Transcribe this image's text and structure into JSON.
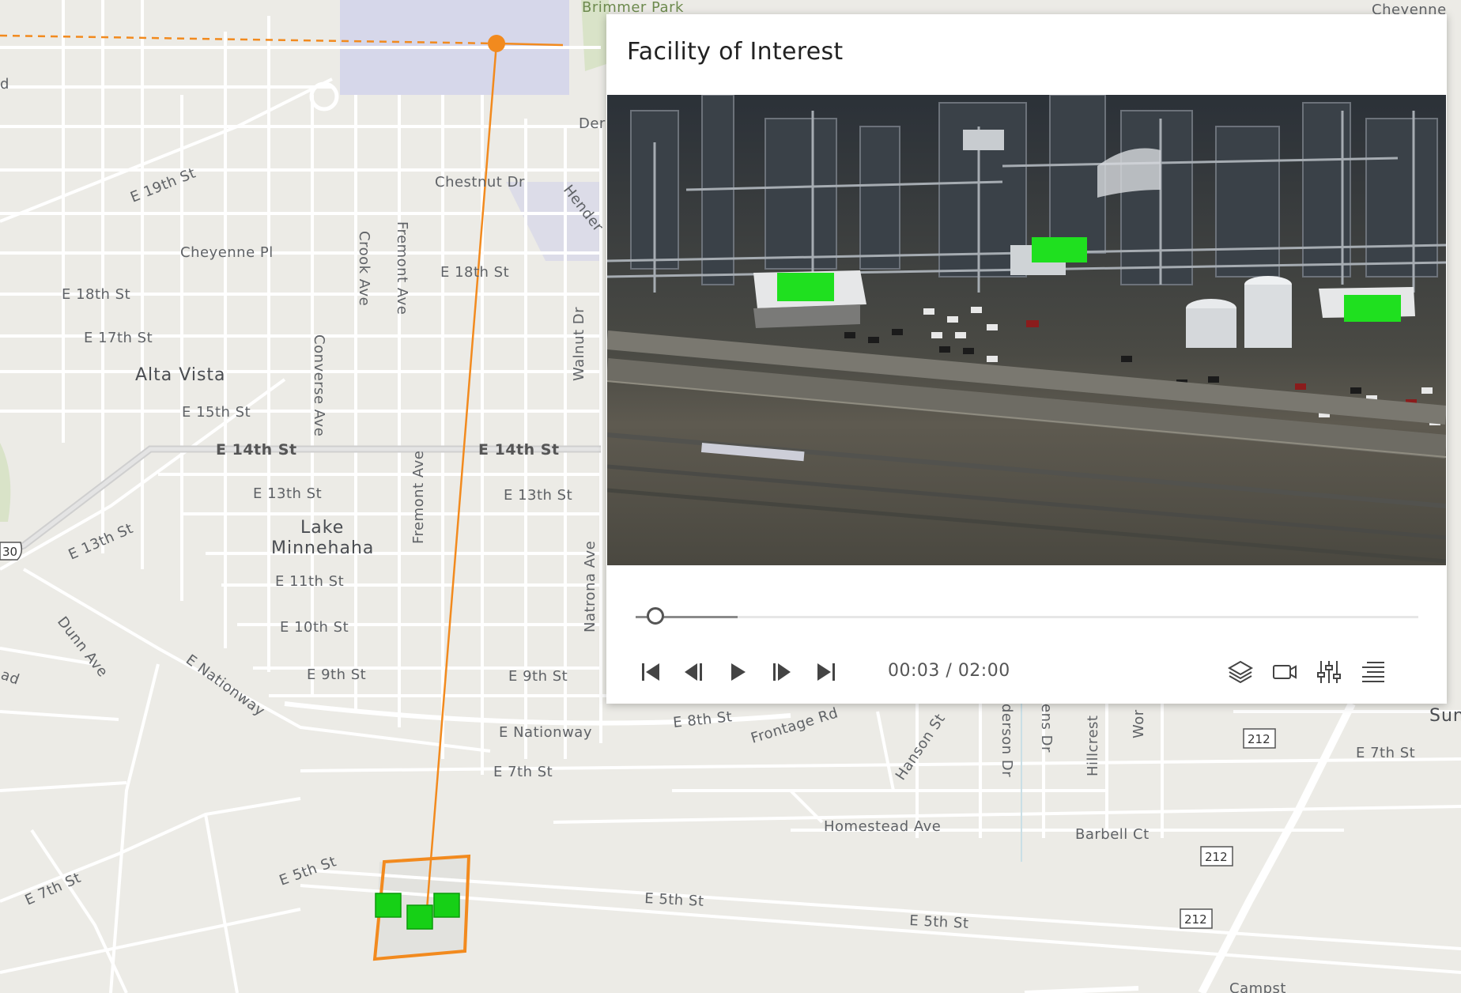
{
  "popup": {
    "title": "Facility of Interest",
    "time_current": "00:03",
    "time_total": "02:00",
    "time_separator": " / ",
    "progress_fraction": 0.025,
    "buffer_fraction": 0.13
  },
  "map": {
    "colors": {
      "background": "#ecebe6",
      "road": "#ffffff",
      "highway": "#d3d3d3",
      "sensor_track": "#f28a1e",
      "footprint": "#f28a1e",
      "detection": "#16d016",
      "park": "#d9e3c8",
      "campus": "#d6d7ea"
    },
    "labels": {
      "brimmer_park": "Brimmer Park",
      "cheyenne_top": "Cheyenne",
      "der": "Der",
      "chestnut_dr": "Chestnut Dr",
      "hender": "Hender",
      "e_19th_st": "E 19th St",
      "cheyenne_pl": "Cheyenne Pl",
      "crook_ave": "Crook Ave",
      "fremont_ave_n": "Fremont Ave",
      "e_18th_st_left": "E 18th St",
      "e_18th_st_right": "E 18th St",
      "e_17th_st": "E 17th St",
      "converse_ave": "Converse Ave",
      "walnut_dr": "Walnut Dr",
      "alta_vista": "Alta Vista",
      "e_15th_st": "E 15th St",
      "e_14th_st_left": "E 14th St",
      "e_14th_st_right": "E 14th St",
      "e_13th_st_a": "E 13th St",
      "e_13th_st_b": "E 13th St",
      "e_13th_st_diag": "E 13th St",
      "lake": "Lake",
      "minnehaha": "Minnehaha",
      "fremont_ave_s": "Fremont Ave",
      "e_11th_st": "E 11th St",
      "natrona_ave": "Natrona Ave",
      "dunn_ave": "Dunn Ave",
      "e_10th_st": "E 10th St",
      "ad": "ad",
      "e_nationway_diag": "E Nationway",
      "e_9th_st_a": "E 9th St",
      "e_9th_st_b": "E 9th St",
      "e_nationway": "E Nationway",
      "e_8th_st": "E 8th St",
      "frontage_rd": "Frontage Rd",
      "hanson_st": "Hanson St",
      "derson_dr": "derson Dr",
      "ens_dr": "ens Dr",
      "hillcrest": "Hillcrest",
      "wor": "Wor",
      "sun": "Sun",
      "e_7th_st_a": "E 7th St",
      "e_7th_st_b": "E 7th St",
      "e_7th_st_c": "E 7th St",
      "homestead_ave": "Homestead Ave",
      "barbell_ct": "Barbell Ct",
      "e_5th_st_a": "E 5th St",
      "e_5th_st_b": "E 5th St",
      "e_5th_st_c": "E 5th St",
      "campst": "Campst",
      "shield_30": "30",
      "shield_212_a": "212",
      "shield_212_b": "212",
      "shield_212_c": "212",
      "d": "d"
    }
  }
}
